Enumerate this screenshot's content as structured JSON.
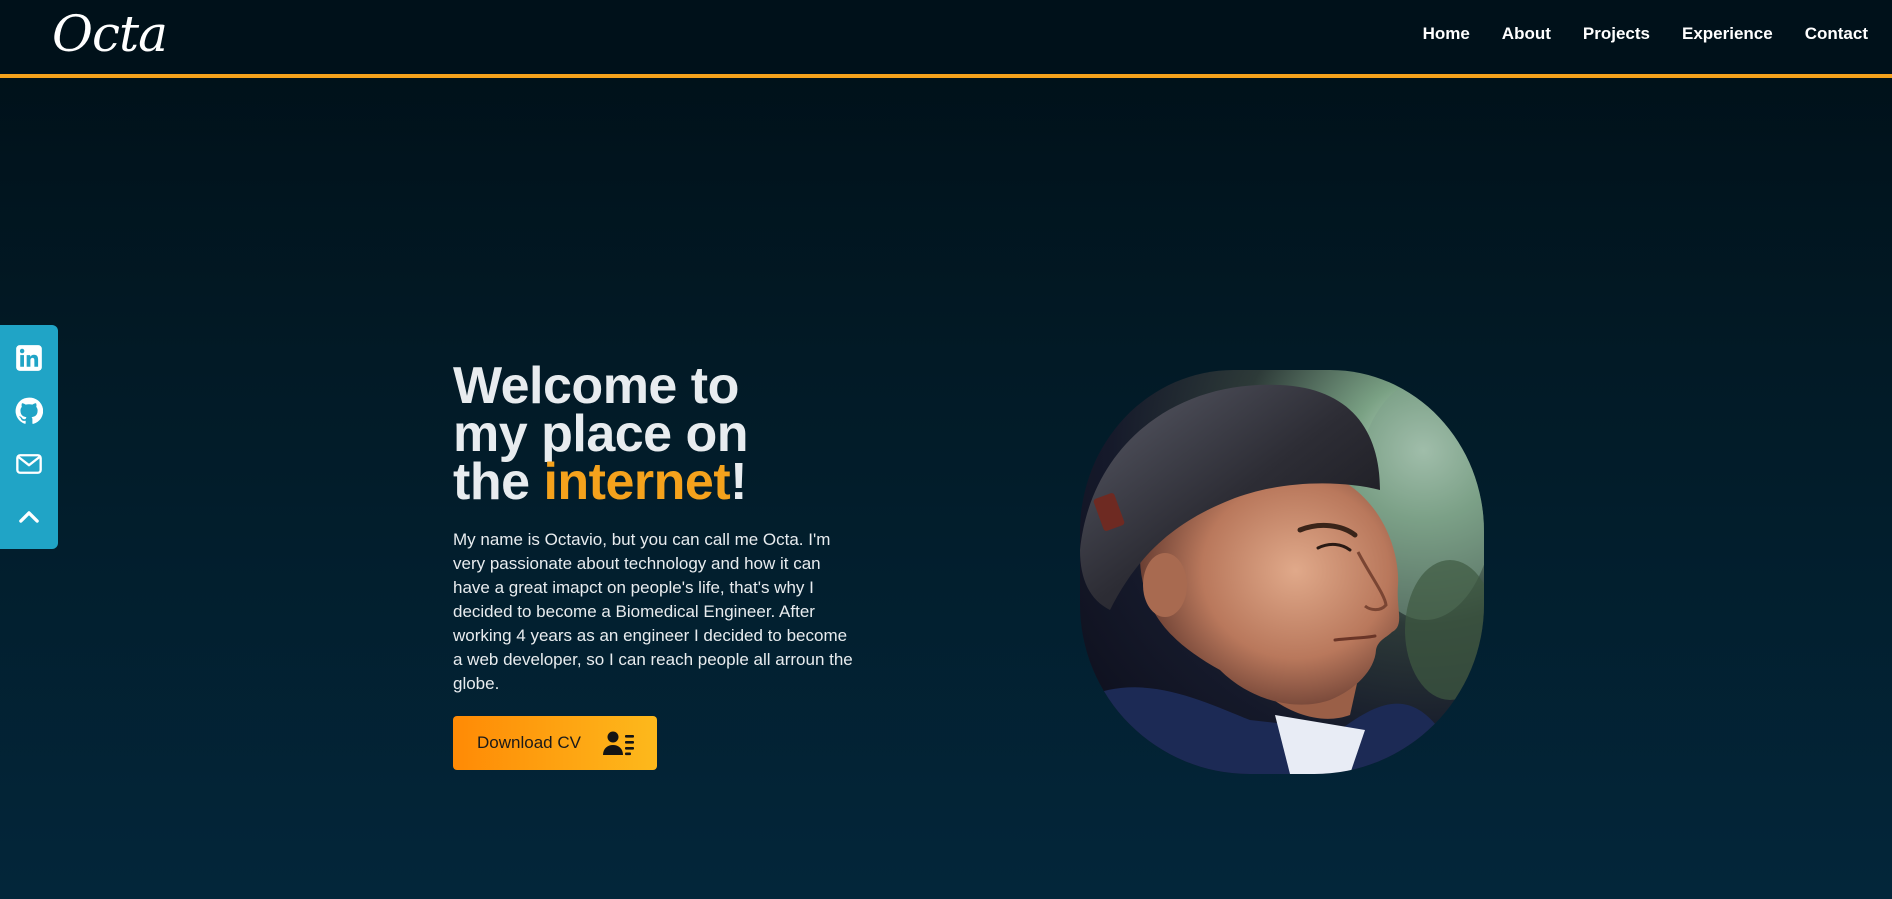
{
  "header": {
    "logo": "Octa",
    "nav": [
      "Home",
      "About",
      "Projects",
      "Experience",
      "Contact"
    ]
  },
  "social": {
    "items": [
      {
        "icon": "linkedin-icon"
      },
      {
        "icon": "github-icon"
      },
      {
        "icon": "mail-icon"
      },
      {
        "icon": "chevron-up-icon"
      }
    ]
  },
  "hero": {
    "title_line1": "Welcome to",
    "title_line2": "my place on",
    "title_line3_prefix": "the ",
    "title_accent": "internet",
    "title_suffix": "!",
    "description": "My name is Octavio, but you can call me Octa. I'm very passionate about technology and how it can have a great imapct on people's life, that's why I decided to become a Biomedical Engineer. After working 4 years as an engineer I decided to become a web developer, so I can reach people all arroun the globe.",
    "cv_button": "Download CV"
  },
  "colors": {
    "accent": "#f5a21c",
    "social_bar": "#20a4c6",
    "nav_bg": "#00111a"
  }
}
